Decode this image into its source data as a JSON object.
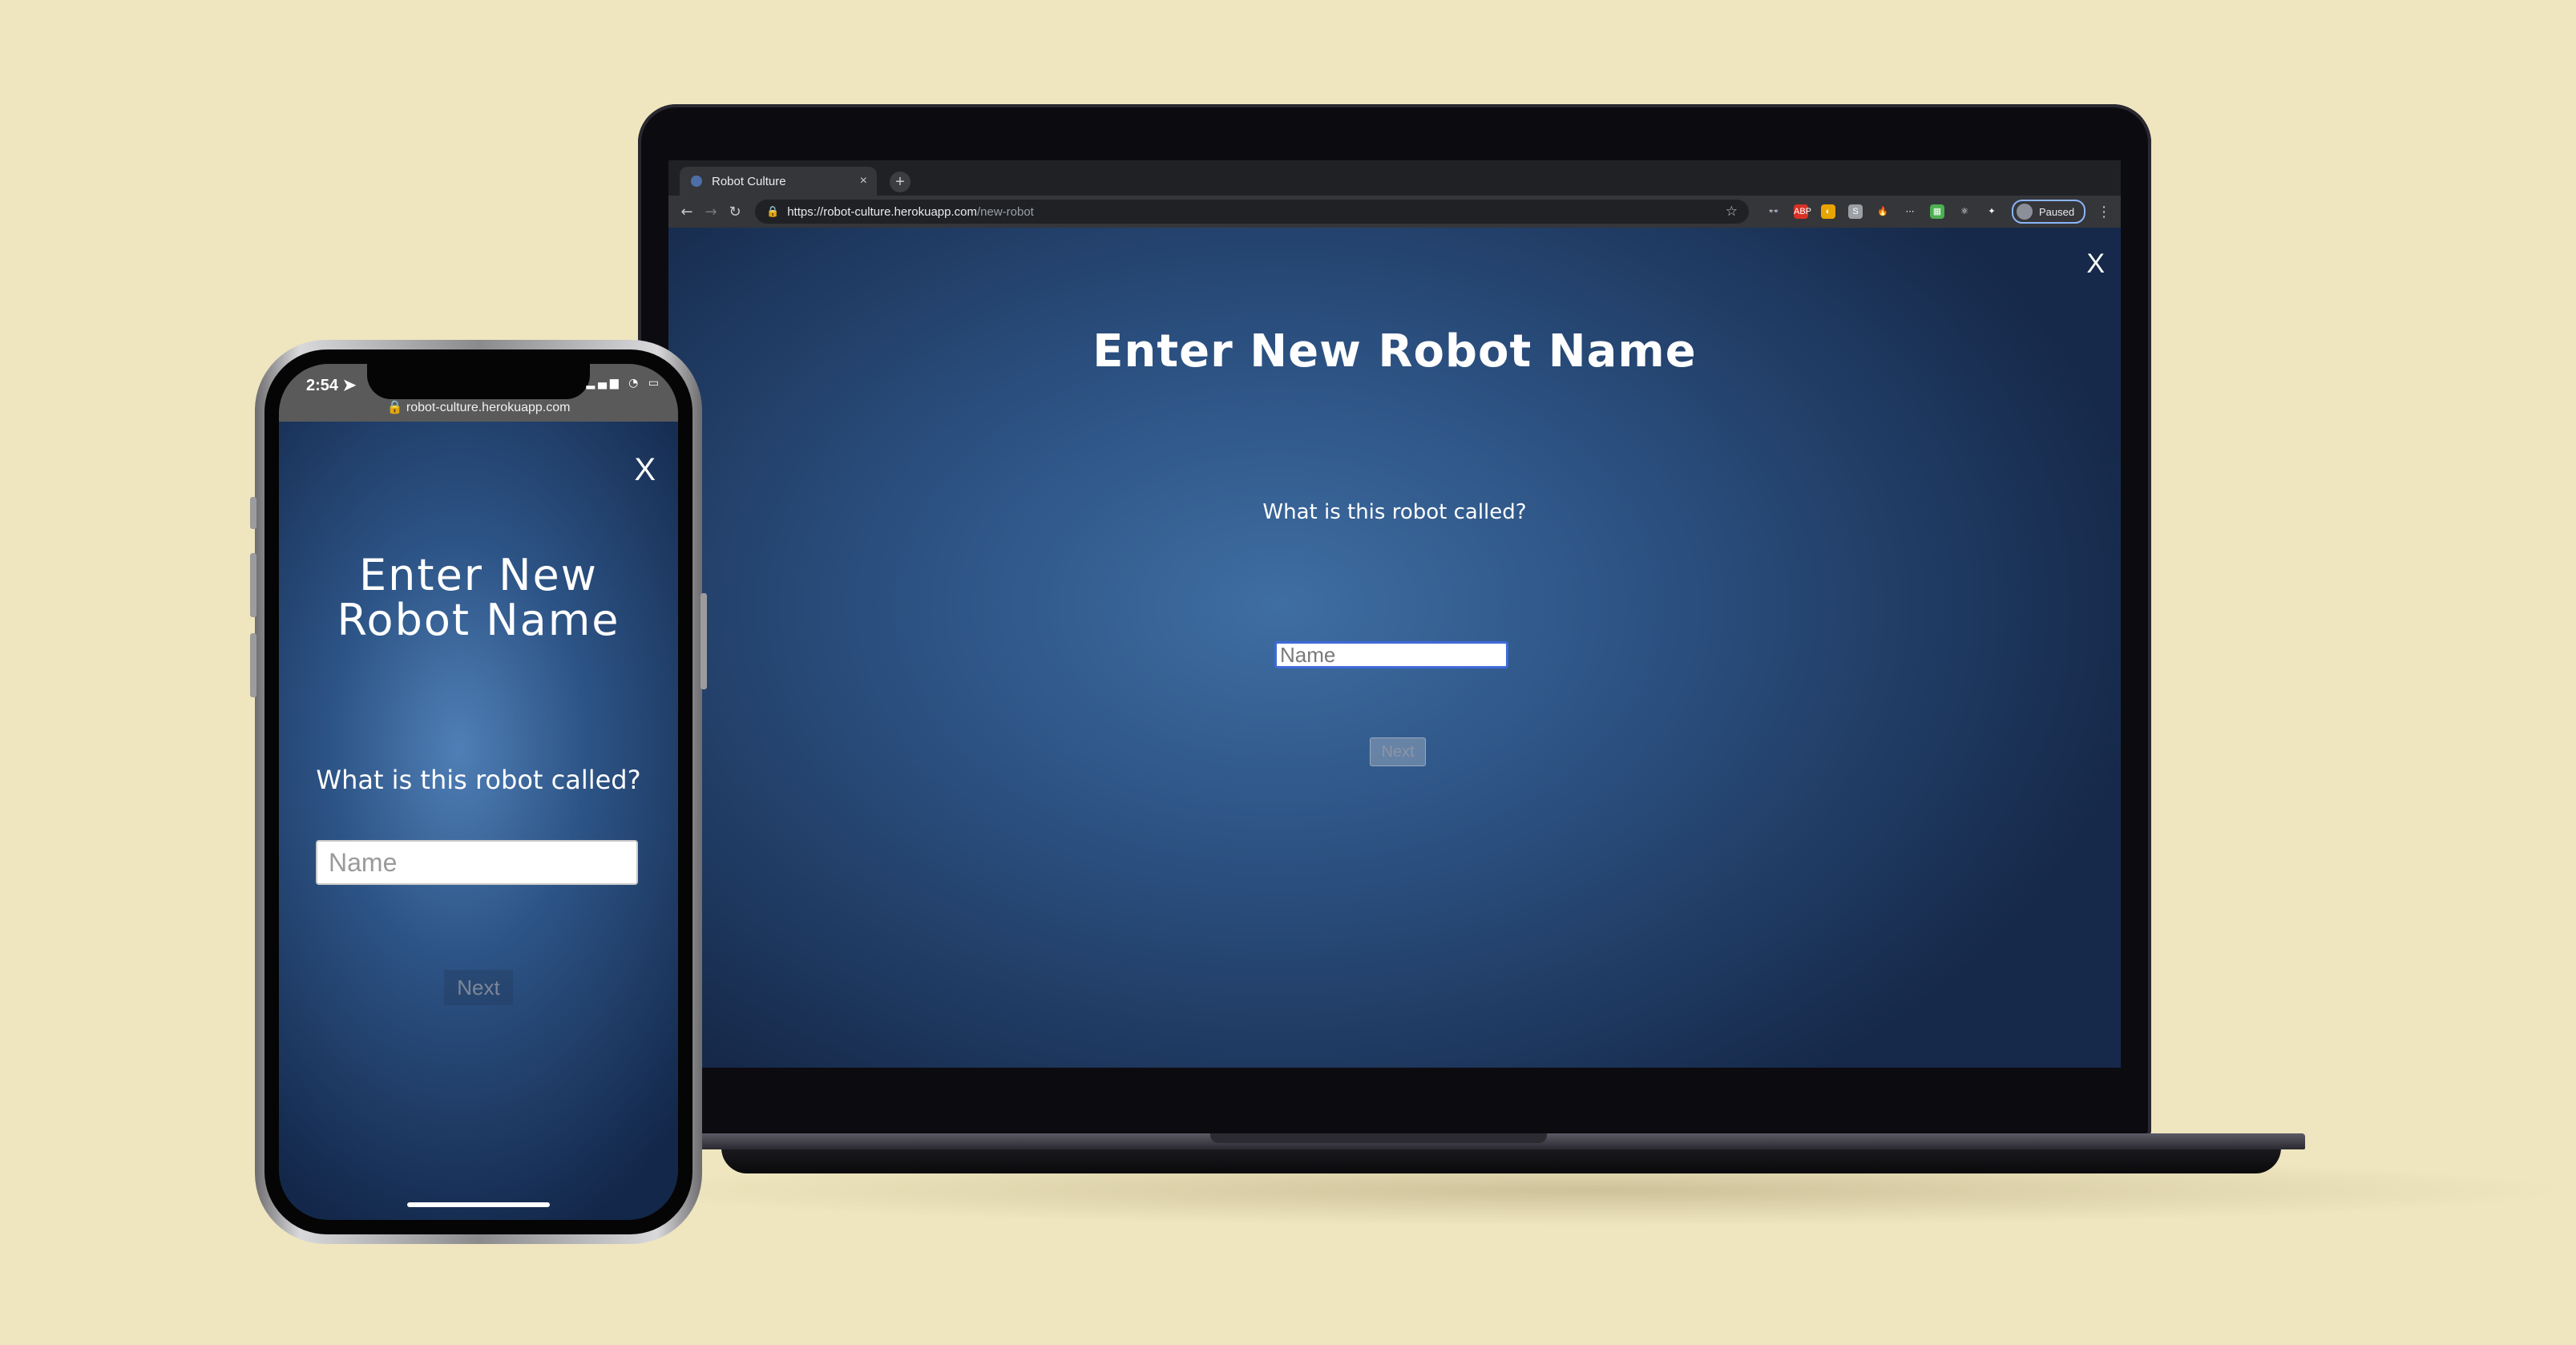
{
  "browser": {
    "tab_title": "Robot Culture",
    "tab_close": "×",
    "new_tab": "+",
    "url_host": "https://robot-culture.herokuapp.com",
    "url_path": "/new-robot",
    "profile_label": "Paused",
    "nav": {
      "back": "←",
      "forward": "→",
      "reload": "↻"
    },
    "extensions": [
      {
        "icon": "incognito-ext-icon",
        "label": "👓",
        "color": "#35363a"
      },
      {
        "icon": "adblock-ext-icon",
        "label": "ABP",
        "color": "#d93025"
      },
      {
        "icon": "honey-ext-icon",
        "label": "◐",
        "color": "#e8a400"
      },
      {
        "icon": "s-ext-icon",
        "label": "S",
        "color": "#9aa0a6"
      },
      {
        "icon": "fire-ext-icon",
        "label": "🔥",
        "color": "#35363a"
      },
      {
        "icon": "dots-ext-icon",
        "label": "⋯",
        "color": "#35363a"
      },
      {
        "icon": "grid-ext-icon",
        "label": "▦",
        "color": "#4caf50"
      },
      {
        "icon": "react-ext-icon",
        "label": "⚛",
        "color": "#35363a"
      },
      {
        "icon": "puzzle-ext-icon",
        "label": "✦",
        "color": "#35363a"
      }
    ]
  },
  "desktop_page": {
    "close_label": "X",
    "title": "Enter New Robot Name",
    "prompt": "What is this robot called?",
    "input_placeholder": "Name",
    "next_label": "Next"
  },
  "phone": {
    "time": "2:54 ➤",
    "status_icons": "▂▄▆ ◔ ▭",
    "url": "🔒 robot-culture.herokuapp.com",
    "close_label": "X",
    "title": "Enter New Robot Name",
    "prompt": "What is this robot called?",
    "input_placeholder": "Name",
    "next_label": "Next"
  },
  "colors": {
    "background": "#efe6bf",
    "page_gradient_center": "#3f6ea3",
    "page_gradient_edge": "#16294a",
    "input_focus_border": "#3f6ad8"
  }
}
